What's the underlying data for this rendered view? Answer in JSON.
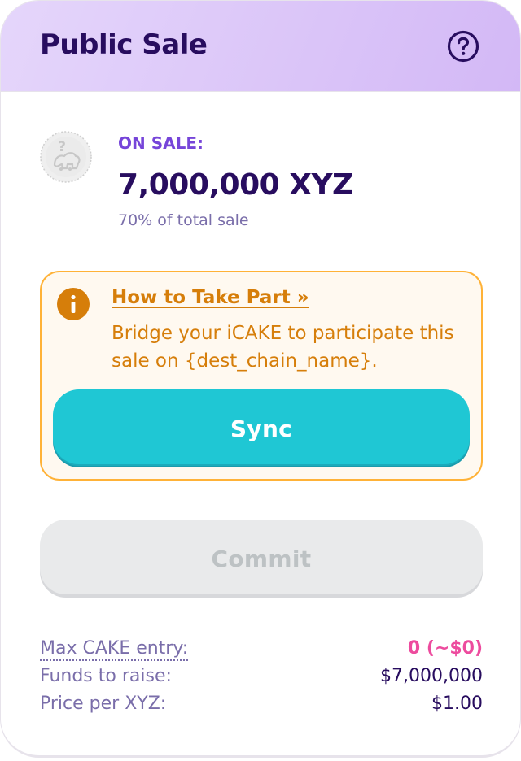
{
  "header": {
    "title": "Public Sale",
    "help_icon": "question-circle-icon"
  },
  "sale": {
    "token_icon": "unknown-token-icon",
    "on_sale_label": "ON SALE:",
    "amount": "7,000,000 XYZ",
    "percent_text": "70% of total sale"
  },
  "info": {
    "icon": "info-icon",
    "link_label": "How to Take Part »",
    "message": "Bridge your iCAKE to participate this sale on {dest_chain_name}.",
    "sync_label": "Sync"
  },
  "commit": {
    "label": "Commit",
    "disabled": true
  },
  "stats": [
    {
      "label": "Max CAKE entry:",
      "value": "0 (~$0)"
    },
    {
      "label": "Funds to raise:",
      "value": "$7,000,000"
    },
    {
      "label": "Price per XYZ:",
      "value": "$1.00"
    }
  ],
  "colors": {
    "primary_text": "#280d5f",
    "secondary_text": "#7a6eaa",
    "accent_purple": "#7645d9",
    "warning": "#d67e0a",
    "warning_border": "#ffb237",
    "sync_button": "#1fc7d4",
    "pink_value": "#ed4b9e"
  }
}
